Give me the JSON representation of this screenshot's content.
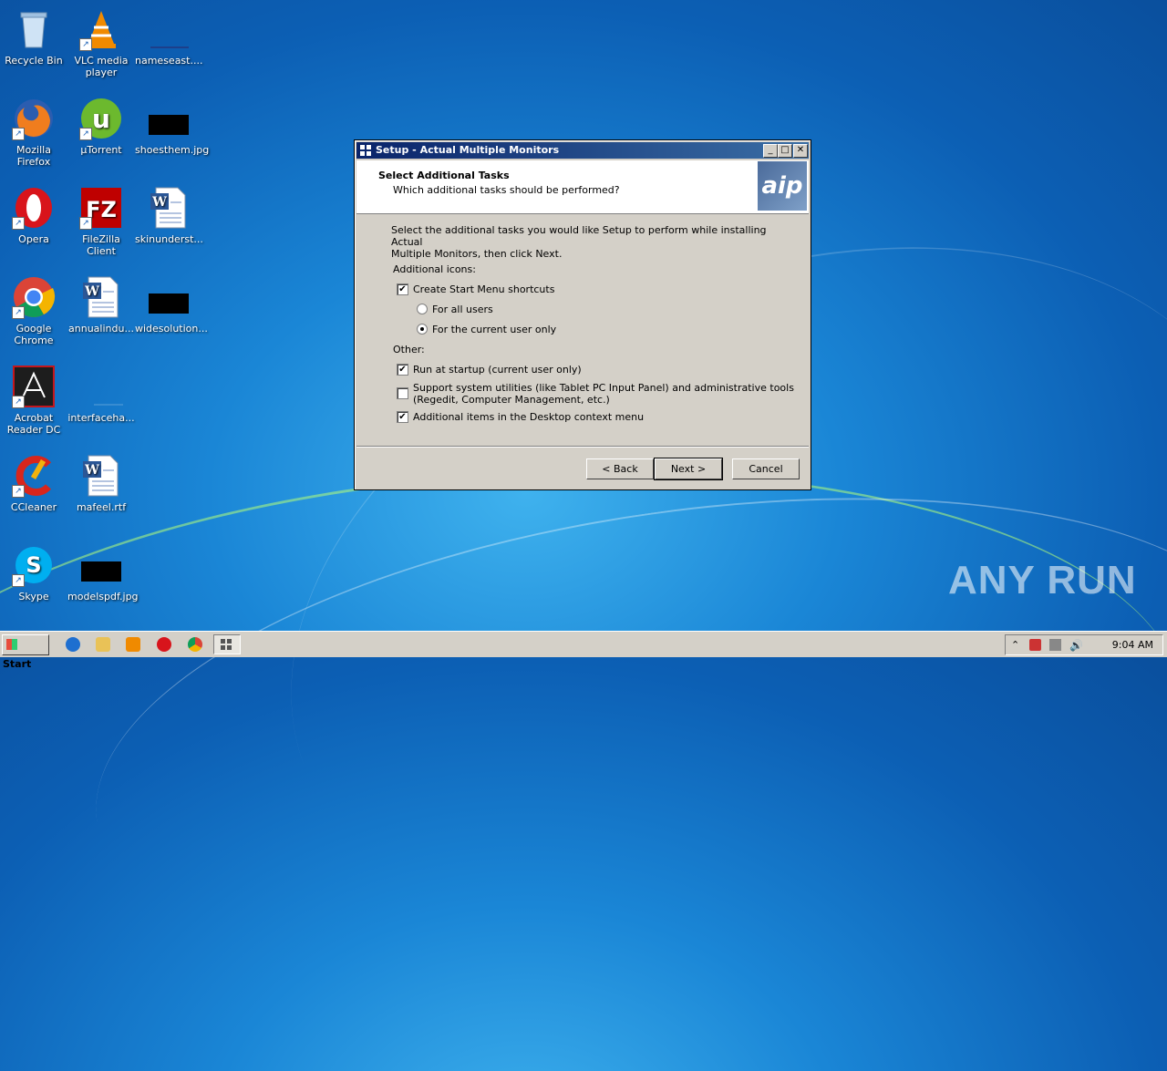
{
  "desktop": {
    "icons": [
      {
        "label": "Recycle Bin"
      },
      {
        "label": "VLC media player"
      },
      {
        "label": "nameseast...."
      },
      {
        "label": "Mozilla Firefox"
      },
      {
        "label": "µTorrent"
      },
      {
        "label": "shoesthem.jpg"
      },
      {
        "label": "Opera"
      },
      {
        "label": "FileZilla Client"
      },
      {
        "label": "skinunderst..."
      },
      {
        "label": "Google Chrome"
      },
      {
        "label": "annualindu..."
      },
      {
        "label": "widesolution..."
      },
      {
        "label": "Acrobat Reader DC"
      },
      {
        "label": "interfaceha..."
      },
      {
        "label": "CCleaner"
      },
      {
        "label": "mafeel.rtf"
      },
      {
        "label": "Skype"
      },
      {
        "label": "modelspdf.jpg"
      }
    ]
  },
  "dialog": {
    "title": "Setup - Actual Multiple Monitors",
    "header_title": "Select Additional Tasks",
    "header_subtitle": "Which additional tasks should be performed?",
    "intro_line1": "Select the additional tasks you would like Setup to perform while installing Actual",
    "intro_line2": "Multiple Monitors, then click Next.",
    "group_icons": "Additional icons:",
    "opt_start_menu": "Create Start Menu shortcuts",
    "opt_all_users": "For all users",
    "opt_current_user": "For the current user only",
    "group_other": "Other:",
    "opt_startup": "Run at startup (current user only)",
    "opt_support_line1": "Support system utilities (like Tablet PC Input Panel) and administrative tools",
    "opt_support_line2": "(Regedit, Computer Management, etc.)",
    "opt_context": "Additional items in the Desktop context menu",
    "back_label": "< Back",
    "next_label": "Next >",
    "cancel_label": "Cancel",
    "logo_text": "aip"
  },
  "taskbar": {
    "start_label": "Start",
    "clock": "9:04 AM"
  },
  "watermark": "ANY RUN"
}
